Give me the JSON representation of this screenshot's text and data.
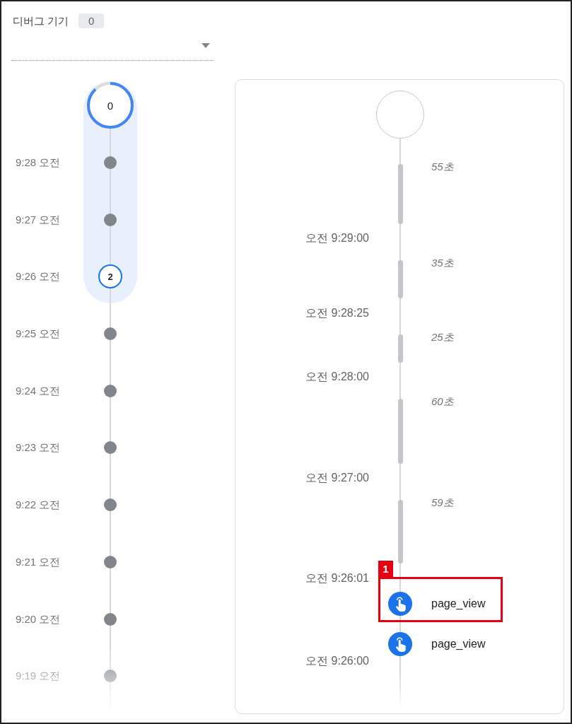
{
  "device_selector": {
    "label": "디버그 기기",
    "count": "0"
  },
  "minutes_stream": {
    "countdown": {
      "count": "0",
      "level": 0.88
    },
    "minutes": [
      {
        "time": "9:28 오전",
        "kind": "dot",
        "selected": true
      },
      {
        "time": "9:27 오전",
        "kind": "dot",
        "selected": true
      },
      {
        "time": "9:26 오전",
        "kind": "count",
        "count": "2",
        "selected": true
      },
      {
        "time": "9:25 오전",
        "kind": "dot",
        "selected": false
      },
      {
        "time": "9:24 오전",
        "kind": "dot",
        "selected": false
      },
      {
        "time": "9:23 오전",
        "kind": "dot",
        "selected": false
      },
      {
        "time": "9:22 오전",
        "kind": "dot",
        "selected": false
      },
      {
        "time": "9:21 오전",
        "kind": "dot",
        "selected": false
      },
      {
        "time": "9:20 오전",
        "kind": "dot",
        "selected": false
      },
      {
        "time": "9:19 오전",
        "kind": "dot",
        "selected": false
      }
    ]
  },
  "seconds_stream": {
    "items": [
      {
        "kind": "gap",
        "duration": "55초"
      },
      {
        "kind": "time",
        "time": "오전 9:29:00"
      },
      {
        "kind": "gap",
        "duration": "35초"
      },
      {
        "kind": "time",
        "time": "오전 9:28:25"
      },
      {
        "kind": "gap",
        "duration": "25초"
      },
      {
        "kind": "time",
        "time": "오전 9:28:00"
      },
      {
        "kind": "gap",
        "duration": "60초"
      },
      {
        "kind": "time",
        "time": "오전 9:27:00"
      },
      {
        "kind": "gap",
        "duration": "59초"
      },
      {
        "kind": "time",
        "time": "오전 9:26:01"
      },
      {
        "kind": "event",
        "name": "page_view",
        "callout": "1"
      },
      {
        "kind": "event",
        "name": "page_view"
      },
      {
        "kind": "time",
        "time": "오전 9:26:00"
      }
    ]
  }
}
